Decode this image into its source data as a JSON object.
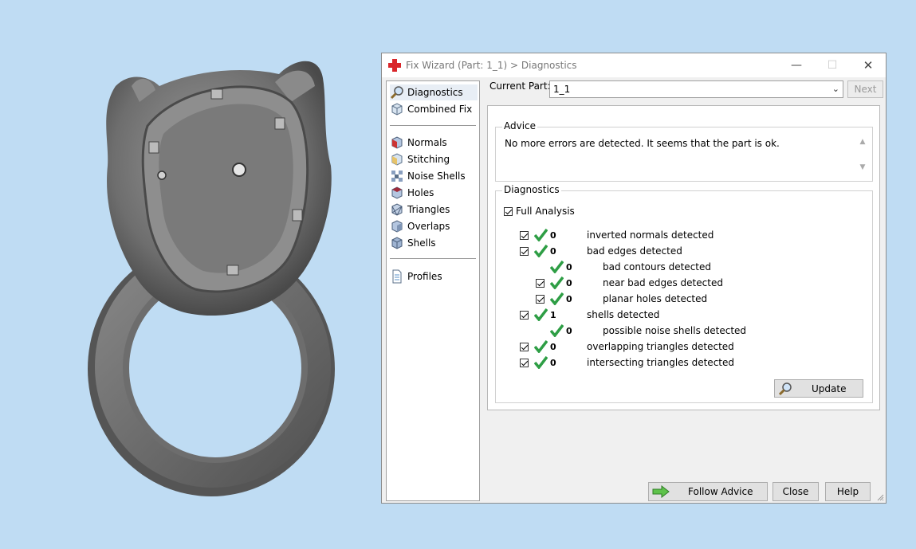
{
  "window": {
    "title": "Fix Wizard (Part: 1_1) > Diagnostics",
    "minimize_glyph": "—",
    "maximize_glyph": "☐",
    "close_glyph": "✕"
  },
  "nav": {
    "items": [
      {
        "label": "Diagnostics",
        "icon": "magnifier-icon",
        "selected": true
      },
      {
        "label": "Combined Fix",
        "icon": "cube-icon"
      },
      {
        "label": "Normals",
        "icon": "normals-cube-icon"
      },
      {
        "label": "Stitching",
        "icon": "stitching-cube-icon"
      },
      {
        "label": "Noise Shells",
        "icon": "noise-shells-icon"
      },
      {
        "label": "Holes",
        "icon": "holes-cube-icon"
      },
      {
        "label": "Triangles",
        "icon": "triangles-cube-icon"
      },
      {
        "label": "Overlaps",
        "icon": "overlaps-cube-icon"
      },
      {
        "label": "Shells",
        "icon": "shells-cube-icon"
      },
      {
        "label": "Profiles",
        "icon": "document-icon"
      }
    ]
  },
  "current_part": {
    "label": "Current Part:",
    "value": "1_1",
    "next_label": "Next"
  },
  "advice": {
    "title": "Advice",
    "text": "No more errors are detected. It seems that the part is ok."
  },
  "diagnostics": {
    "title": "Diagnostics",
    "full_analysis_label": "Full Analysis",
    "rows": [
      {
        "count": "0",
        "desc": "inverted normals detected",
        "checkbox": true
      },
      {
        "count": "0",
        "desc": "bad edges detected",
        "checkbox": true
      },
      {
        "count": "0",
        "desc": "bad contours detected",
        "checkbox": false
      },
      {
        "count": "0",
        "desc": "near bad edges detected",
        "checkbox": true
      },
      {
        "count": "0",
        "desc": "planar holes detected",
        "checkbox": true
      },
      {
        "count": "1",
        "desc": "shells detected",
        "checkbox": true
      },
      {
        "count": "0",
        "desc": "possible noise shells detected",
        "checkbox": false
      },
      {
        "count": "0",
        "desc": "overlapping triangles detected",
        "checkbox": true
      },
      {
        "count": "0",
        "desc": "intersecting triangles detected",
        "checkbox": true
      }
    ],
    "update_label": "Update"
  },
  "buttons": {
    "follow_advice": "Follow Advice",
    "close": "Close",
    "help": "Help"
  },
  "colors": {
    "background": "#bfdcf3",
    "check_green": "#2e9e45",
    "title_cross_red": "#d9262b"
  }
}
